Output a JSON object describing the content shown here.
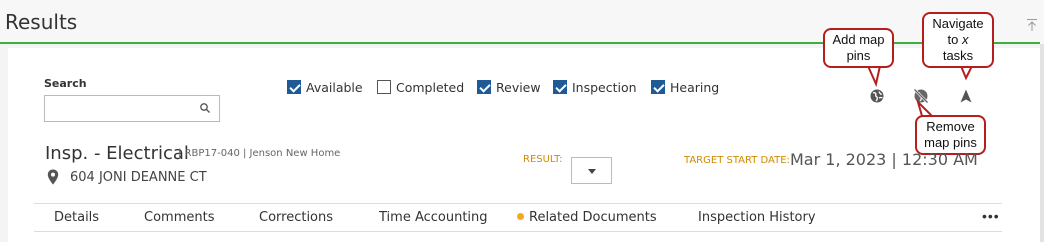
{
  "header": {
    "title": "Results"
  },
  "search": {
    "label": "Search",
    "value": "",
    "placeholder": ""
  },
  "filters": [
    {
      "label": "Available",
      "checked": true
    },
    {
      "label": "Completed",
      "checked": false
    },
    {
      "label": "Review",
      "checked": true
    },
    {
      "label": "Inspection",
      "checked": true
    },
    {
      "label": "Hearing",
      "checked": true
    }
  ],
  "toolbar_icons": [
    "globe-icon",
    "globe-slash-icon",
    "navigate-arrow-icon"
  ],
  "callouts": {
    "add_map_pins": "Add map pins",
    "navigate": "Navigate to x tasks",
    "remove_map_pins": "Remove map pins"
  },
  "record": {
    "title": "Insp. - Electrical",
    "meta": "| RBP17-040 | Jenson New Home",
    "address": "604 JONI DEANNE CT",
    "result_label": "RESULT:",
    "result_value": "",
    "target_start_label": "TARGET START DATE:",
    "target_start_value": "Mar 1, 2023 | 12:30 AM"
  },
  "tabs": [
    {
      "label": "Details"
    },
    {
      "label": "Comments"
    },
    {
      "label": "Corrections"
    },
    {
      "label": "Time Accounting"
    },
    {
      "label": "Related Documents",
      "indicator": true
    },
    {
      "label": "Inspection History"
    }
  ],
  "more_label": "•••",
  "colors": {
    "accent_green": "#3fae3f",
    "checkbox_blue": "#1f5a96",
    "label_orange": "#d08a00",
    "callout_red": "#b51e1e",
    "indicator_orange": "#f5a623"
  }
}
